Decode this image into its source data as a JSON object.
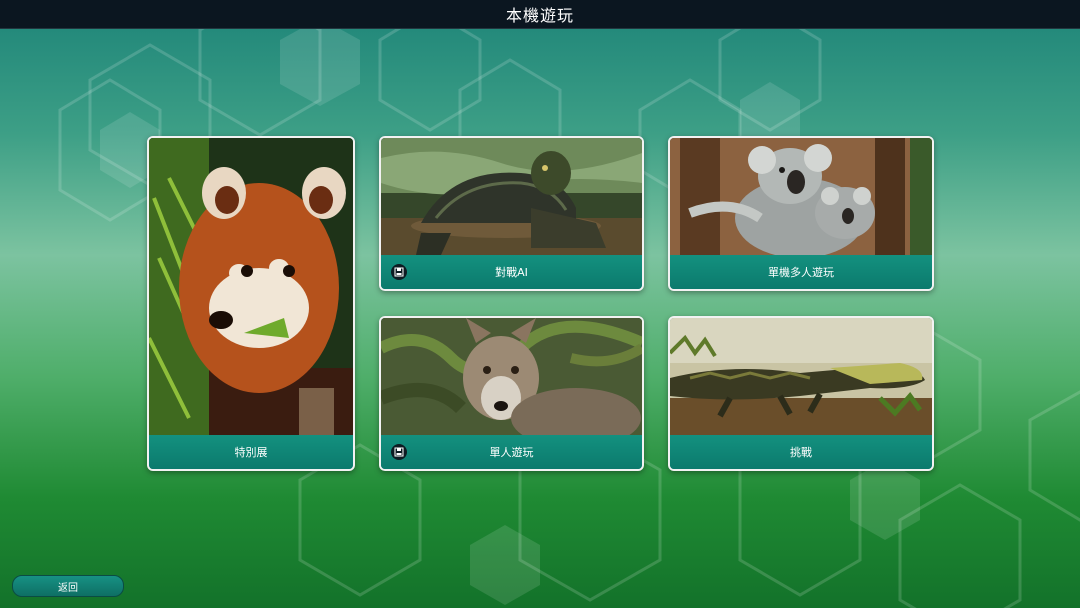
{
  "header": {
    "title": "本機遊玩"
  },
  "cards": {
    "special": {
      "label": "特別展"
    },
    "vs_ai": {
      "label": "對戰AI",
      "icon": "save-icon"
    },
    "local_multi": {
      "label": "單機多人遊玩"
    },
    "single": {
      "label": "單人遊玩",
      "icon": "save-icon"
    },
    "challenge": {
      "label": "挑戰"
    }
  },
  "footer": {
    "back_label": "返回"
  },
  "colors": {
    "topbar": "#0b1620",
    "label_bar": "#0c7a6d",
    "card_border": "#f2f2f2"
  }
}
